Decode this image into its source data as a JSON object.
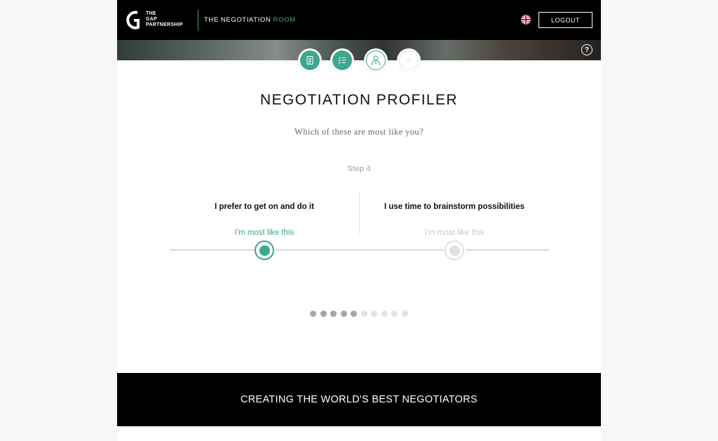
{
  "header": {
    "logo_lines": [
      "THE",
      "GAP",
      "PARTNERSHIP"
    ],
    "app_title_main": "THE NEGOTIATION ",
    "app_title_accent": "ROOM",
    "logout_label": "LOGOUT",
    "language": "en-GB"
  },
  "banner": {
    "help_label": "?"
  },
  "steps": [
    {
      "name": "document",
      "state": "complete"
    },
    {
      "name": "checklist",
      "state": "complete"
    },
    {
      "name": "profile",
      "state": "current"
    },
    {
      "name": "check",
      "state": "pending"
    }
  ],
  "main": {
    "title": "NEGOTIATION PROFILER",
    "subtitle": "Which of these are most like you?",
    "step_label": "Step 4"
  },
  "options": [
    {
      "text": "I prefer to get on and  do it",
      "like_label": "I'm most like this",
      "selected": true
    },
    {
      "text": "I use time to brainstorm possibilities",
      "like_label": "I'm most like this",
      "selected": false
    }
  ],
  "progress": {
    "total": 10,
    "completed": 5
  },
  "footer": {
    "tagline": "CREATING THE WORLD'S BEST NEGOTIATORS"
  },
  "colors": {
    "accent": "#3aa78e",
    "inactive": "#e0e0e0",
    "dot_done": "#a5a5a5",
    "dot_todo": "#e3e3e3",
    "header_bg": "#000000"
  }
}
